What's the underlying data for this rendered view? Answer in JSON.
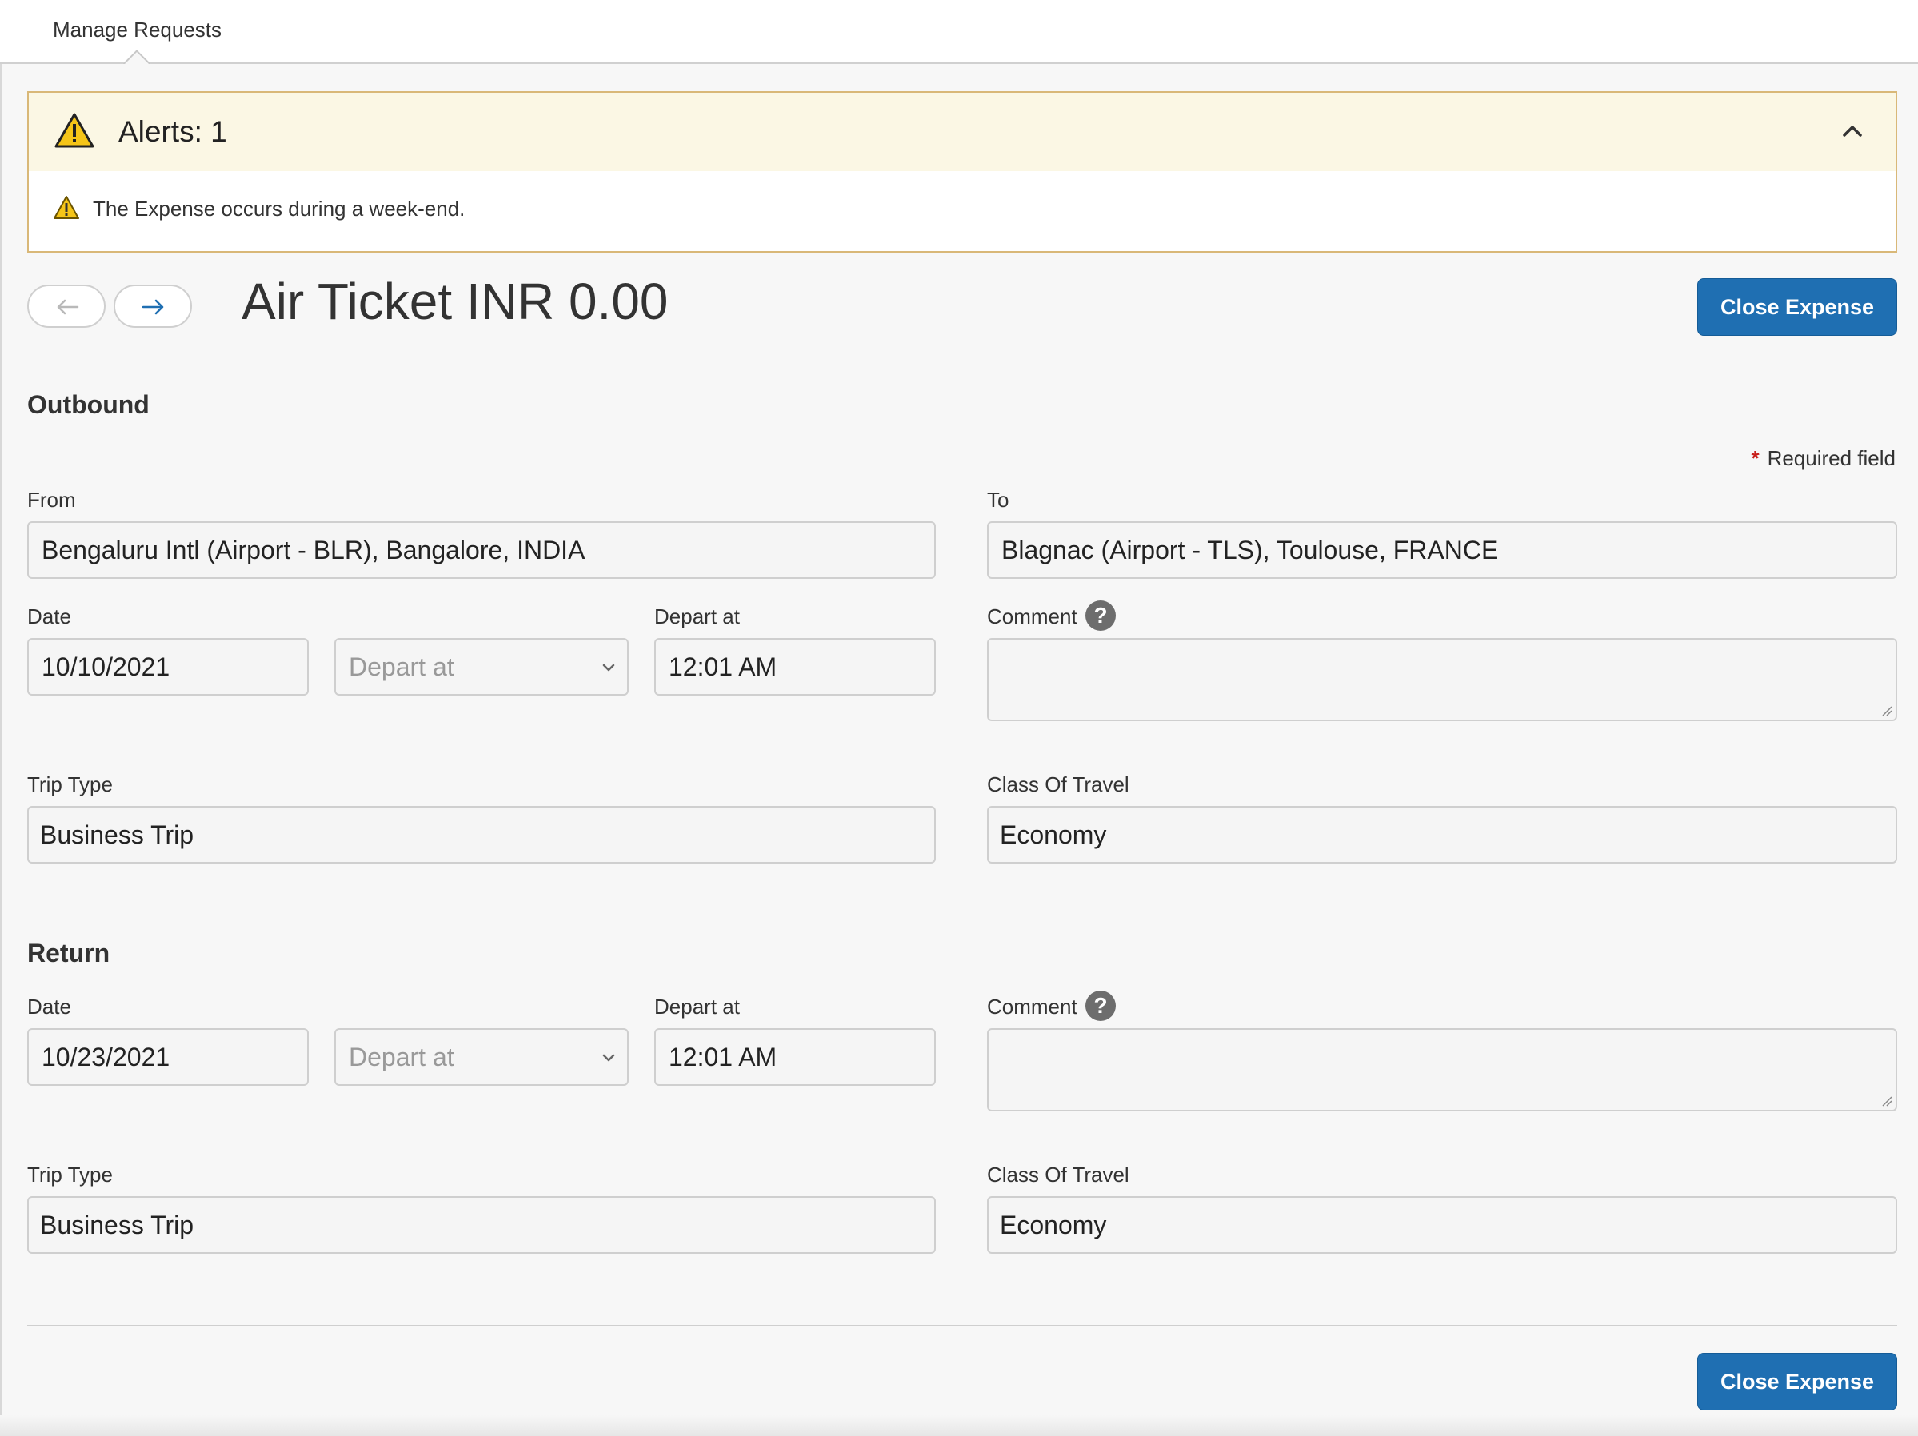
{
  "tabs": {
    "active_label": "Manage Requests"
  },
  "alert": {
    "title": "Alerts: 1",
    "message": "The Expense occurs during a week-end."
  },
  "header": {
    "title": "Air Ticket INR 0.00",
    "close_button": "Close Expense"
  },
  "required_note": "Required field",
  "outbound": {
    "section_title": "Outbound",
    "from_label": "From",
    "from_value": "Bengaluru Intl (Airport - BLR), Bangalore, INDIA",
    "to_label": "To",
    "to_value": "Blagnac (Airport - TLS), Toulouse, FRANCE",
    "date_label": "Date",
    "date_value": "10/10/2021",
    "depart_select_placeholder": "Depart at",
    "depart_label": "Depart at",
    "depart_value": "12:01 AM",
    "comment_label": "Comment",
    "comment_value": "",
    "trip_type_label": "Trip Type",
    "trip_type_value": "Business Trip",
    "class_label": "Class Of Travel",
    "class_value": "Economy"
  },
  "return": {
    "section_title": "Return",
    "date_label": "Date",
    "date_value": "10/23/2021",
    "depart_select_placeholder": "Depart at",
    "depart_label": "Depart at",
    "depart_value": "12:01 AM",
    "comment_label": "Comment",
    "comment_value": "",
    "trip_type_label": "Trip Type",
    "trip_type_value": "Business Trip",
    "class_label": "Class Of Travel",
    "class_value": "Economy"
  },
  "footer": {
    "close_button": "Close Expense"
  },
  "colors": {
    "primary": "#1f6fb2",
    "alert_border": "#d9b878",
    "alert_header_bg": "#fbf7e4",
    "warning_yellow": "#f5c518",
    "required_star": "#c8201c"
  },
  "icons": {
    "warning": "warning-icon",
    "collapse": "chevron-up-icon",
    "prev": "arrow-left-icon",
    "next": "arrow-right-icon",
    "help": "help-icon",
    "select": "chevron-down-icon"
  }
}
